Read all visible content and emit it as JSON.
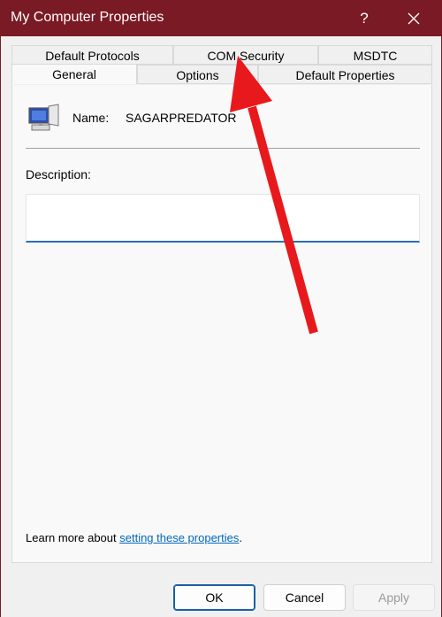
{
  "window": {
    "title": "My Computer Properties",
    "help_label": "?",
    "close_label": "close"
  },
  "tabs": {
    "row1": [
      {
        "label": "Default Protocols"
      },
      {
        "label": "COM Security"
      },
      {
        "label": "MSDTC"
      }
    ],
    "row2": [
      {
        "label": "General",
        "active": true
      },
      {
        "label": "Options"
      },
      {
        "label": "Default Properties"
      }
    ]
  },
  "general": {
    "name_label": "Name:",
    "name_value": "SAGARPREDATOR",
    "description_label": "Description:",
    "description_value": "",
    "learn_more_prefix": "Learn more about ",
    "learn_more_link": "setting these properties",
    "learn_more_suffix": "."
  },
  "buttons": {
    "ok": "OK",
    "cancel": "Cancel",
    "apply": "Apply"
  },
  "colors": {
    "titlebar": "#7a1a24",
    "link": "#0067c0",
    "arrow": "#e8191c",
    "input_underline": "#2a6fb0"
  },
  "annotation": {
    "type": "arrow",
    "color": "red",
    "points_to": "COM Security"
  }
}
